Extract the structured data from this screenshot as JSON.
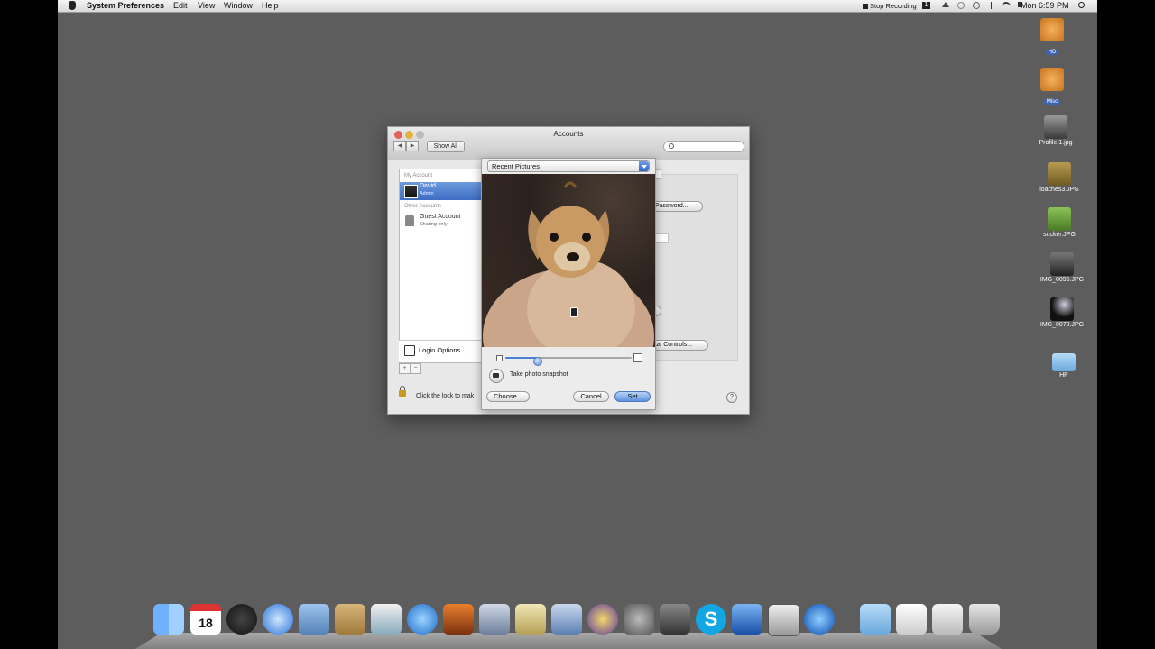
{
  "menubar": {
    "app_name": "System Preferences",
    "menus": [
      "Edit",
      "View",
      "Window",
      "Help"
    ],
    "stop_recording": "Stop Recording",
    "clock": "Mon 6:59 PM"
  },
  "window": {
    "title": "Accounts",
    "show_all": "Show All",
    "search_placeholder": ""
  },
  "sidebar": {
    "my_account_header": "My Account",
    "other_accounts_header": "Other Accounts",
    "accounts": [
      {
        "name": "David",
        "role": "Admin",
        "selected": true
      },
      {
        "name": "Guest Account",
        "role": "Sharing only",
        "selected": false
      }
    ],
    "login_options": "Login Options",
    "add": "+",
    "remove": "−"
  },
  "lock_text": "Click the lock to mak",
  "help": "?",
  "right_pane": {
    "password_button": "Password...",
    "parental_controls_button": "ntal Controls..."
  },
  "picker": {
    "source_selected": "Recent Pictures",
    "zoom_fraction": 0.25,
    "snapshot_label": "Take photo snapshot",
    "choose": "Choose...",
    "cancel": "Cancel",
    "set": "Set"
  },
  "desktop_icons": [
    {
      "label": "HD",
      "icon": "hard-drive-icon",
      "color": "#d98a3a"
    },
    {
      "label": "Misc",
      "icon": "hard-drive-icon",
      "color": "#d98a3a"
    },
    {
      "label": "Profile 1.jpg",
      "icon": "image-file-icon",
      "color": "#6b6b6b"
    },
    {
      "label": "loaches3.JPG",
      "icon": "image-file-icon",
      "color": "#8d7b3e"
    },
    {
      "label": "sucker.JPG",
      "icon": "image-file-icon",
      "color": "#6e9a3e"
    },
    {
      "label": "IMG_0095.JPG",
      "icon": "image-file-icon",
      "color": "#444444"
    },
    {
      "label": "IMG_0079.JPG",
      "icon": "image-file-icon",
      "color": "#1c2330"
    },
    {
      "label": "HP",
      "icon": "folder-icon",
      "color": "#8fc2ea"
    }
  ],
  "dock": {
    "calendar_day": "18",
    "items": [
      "finder",
      "ical",
      "dashboard",
      "safari",
      "mail",
      "address-book",
      "iphoto",
      "itunes",
      "photo-booth",
      "system-widget",
      "preview",
      "dictionary",
      "quicktime",
      "system-preferences",
      "expose",
      "skype",
      "spaces",
      "x11",
      "network",
      "documents",
      "downloads",
      "activity",
      "trash"
    ]
  }
}
